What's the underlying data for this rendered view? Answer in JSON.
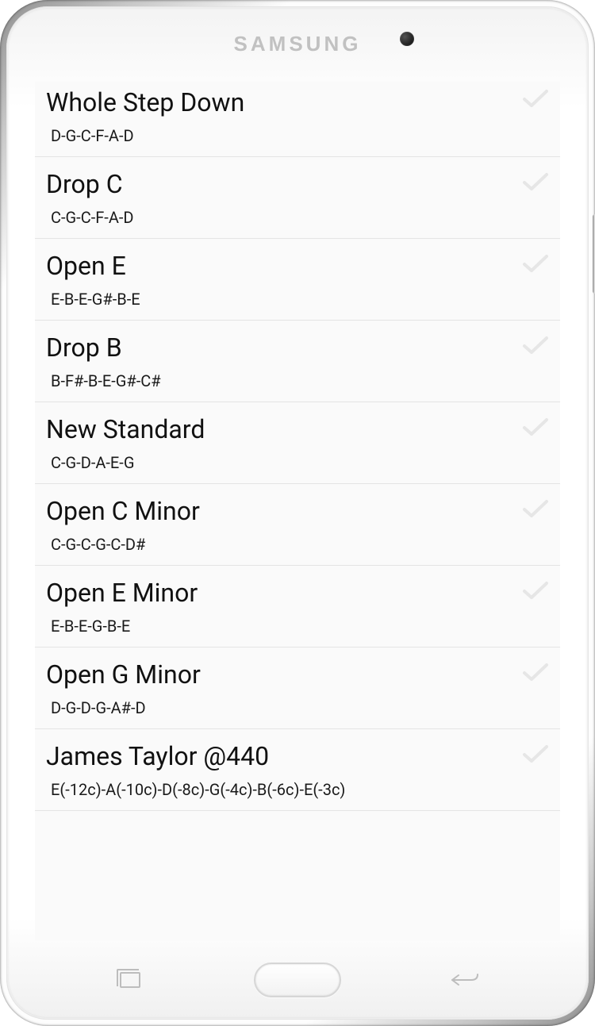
{
  "device": {
    "brand": "SAMSUNG"
  },
  "tunings": [
    {
      "name": "Whole Step Down",
      "notes": "D-G-C-F-A-D"
    },
    {
      "name": "Drop C",
      "notes": "C-G-C-F-A-D"
    },
    {
      "name": "Open E",
      "notes": "E-B-E-G#-B-E"
    },
    {
      "name": "Drop B",
      "notes": "B-F#-B-E-G#-C#"
    },
    {
      "name": "New Standard",
      "notes": "C-G-D-A-E-G"
    },
    {
      "name": "Open C Minor",
      "notes": "C-G-C-G-C-D#"
    },
    {
      "name": "Open E Minor",
      "notes": "E-B-E-G-B-E"
    },
    {
      "name": "Open G Minor",
      "notes": "D-G-D-G-A#-D"
    },
    {
      "name": "James Taylor @440",
      "notes": "E(-12c)-A(-10c)-D(-8c)-G(-4c)-B(-6c)-E(-3c)"
    }
  ]
}
